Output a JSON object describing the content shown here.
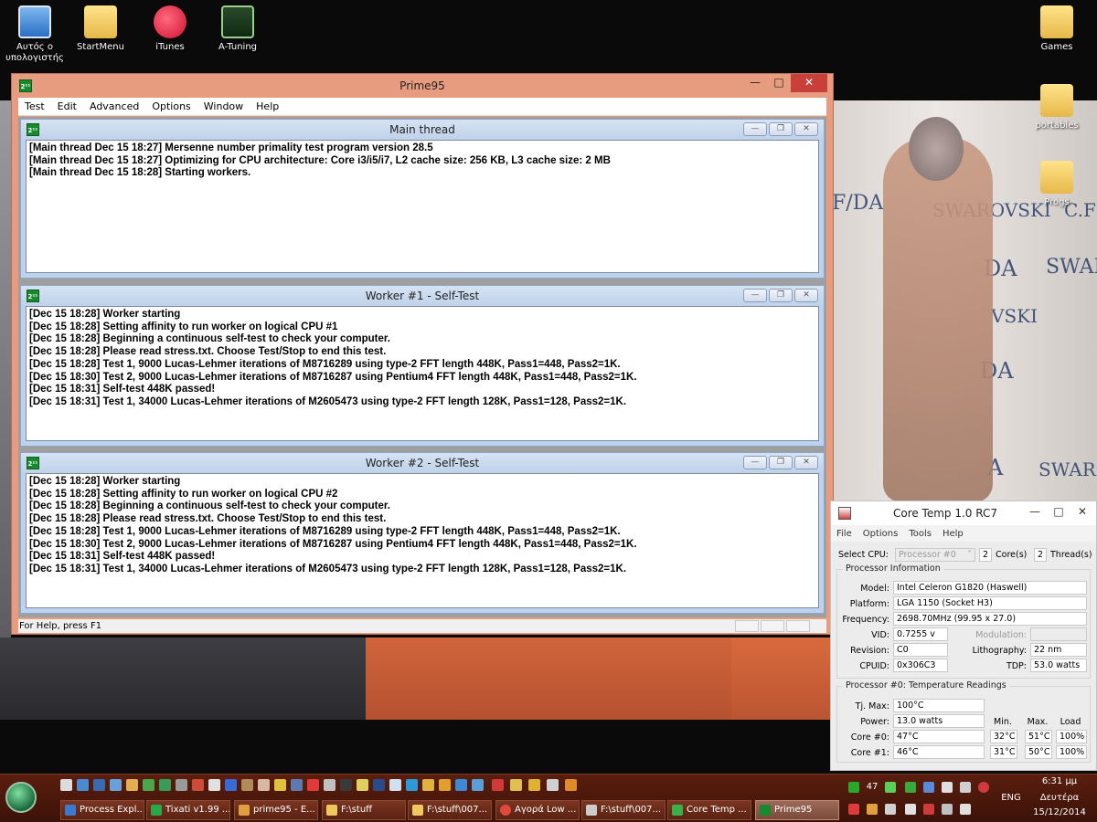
{
  "desktop": {
    "icons": [
      {
        "label": "Αυτός ο υπολογιστής"
      },
      {
        "label": "StartMenu"
      },
      {
        "label": "iTunes"
      },
      {
        "label": "A-Tuning"
      },
      {
        "label": "Games"
      },
      {
        "label": "portables"
      },
      {
        "label": "Progs"
      }
    ],
    "wallpaper_text": [
      "F/DA",
      "SWAROVSKI",
      "C.F",
      "DA",
      "SWAR",
      "VSKI",
      "DA",
      "A",
      "SWARO"
    ]
  },
  "prime95": {
    "title": "Prime95",
    "icon_text": "2¹¹",
    "menu": [
      "Test",
      "Edit",
      "Advanced",
      "Options",
      "Window",
      "Help"
    ],
    "status": "For Help, press F1",
    "windows": [
      {
        "title": "Main thread",
        "lines": [
          "[Main thread Dec 15 18:27] Mersenne number primality test program version 28.5",
          "[Main thread Dec 15 18:27] Optimizing for CPU architecture: Core i3/i5/i7, L2 cache size: 256 KB, L3 cache size: 2 MB",
          "[Main thread Dec 15 18:28] Starting workers."
        ]
      },
      {
        "title": "Worker #1 - Self-Test",
        "lines": [
          "[Dec 15 18:28] Worker starting",
          "[Dec 15 18:28] Setting affinity to run worker on logical CPU #1",
          "[Dec 15 18:28] Beginning a continuous self-test to check your computer.",
          "[Dec 15 18:28] Please read stress.txt.  Choose Test/Stop to end this test.",
          "[Dec 15 18:28] Test 1, 9000 Lucas-Lehmer iterations of M8716289 using type-2 FFT length 448K, Pass1=448, Pass2=1K.",
          "[Dec 15 18:30] Test 2, 9000 Lucas-Lehmer iterations of M8716287 using Pentium4 FFT length 448K, Pass1=448, Pass2=1K.",
          "[Dec 15 18:31] Self-test 448K passed!",
          "[Dec 15 18:31] Test 1, 34000 Lucas-Lehmer iterations of M2605473 using type-2 FFT length 128K, Pass1=128, Pass2=1K."
        ]
      },
      {
        "title": "Worker #2 - Self-Test",
        "lines": [
          "[Dec 15 18:28] Worker starting",
          "[Dec 15 18:28] Setting affinity to run worker on logical CPU #2",
          "[Dec 15 18:28] Beginning a continuous self-test to check your computer.",
          "[Dec 15 18:28] Please read stress.txt.  Choose Test/Stop to end this test.",
          "[Dec 15 18:28] Test 1, 9000 Lucas-Lehmer iterations of M8716289 using type-2 FFT length 448K, Pass1=448, Pass2=1K.",
          "[Dec 15 18:30] Test 2, 9000 Lucas-Lehmer iterations of M8716287 using Pentium4 FFT length 448K, Pass1=448, Pass2=1K.",
          "[Dec 15 18:31] Self-test 448K passed!",
          "[Dec 15 18:31] Test 1, 34000 Lucas-Lehmer iterations of M2605473 using type-2 FFT length 128K, Pass1=128, Pass2=1K."
        ]
      }
    ]
  },
  "coretemp": {
    "title": "Core Temp 1.0 RC7",
    "menu": [
      "File",
      "Options",
      "Tools",
      "Help"
    ],
    "select_cpu_label": "Select CPU:",
    "select_cpu_value": "Processor #0",
    "cores_value": "2",
    "cores_label": "Core(s)",
    "threads_value": "2",
    "threads_label": "Thread(s)",
    "proc_info_title": "Processor Information",
    "model_label": "Model:",
    "model_value": "Intel Celeron G1820 (Haswell)",
    "platform_label": "Platform:",
    "platform_value": "LGA 1150 (Socket H3)",
    "frequency_label": "Frequency:",
    "frequency_value": "2698.70MHz (99.95 x 27.0)",
    "vid_label": "VID:",
    "vid_value": "0.7255 v",
    "modulation_label": "Modulation:",
    "modulation_value": "",
    "revision_label": "Revision:",
    "revision_value": "C0",
    "lithography_label": "Lithography:",
    "lithography_value": "22 nm",
    "cpuid_label": "CPUID:",
    "cpuid_value": "0x306C3",
    "tdp_label": "TDP:",
    "tdp_value": "53.0 watts",
    "temp_title": "Processor #0: Temperature Readings",
    "tjmax_label": "Tj. Max:",
    "tjmax_value": "100°C",
    "power_label": "Power:",
    "power_value": "13.0 watts",
    "col_min": "Min.",
    "col_max": "Max.",
    "col_load": "Load",
    "cores": [
      {
        "label": "Core #0:",
        "temp": "47°C",
        "min": "32°C",
        "max": "51°C",
        "load": "100%"
      },
      {
        "label": "Core #1:",
        "temp": "46°C",
        "min": "31°C",
        "max": "50°C",
        "load": "100%"
      }
    ]
  },
  "taskbar": {
    "buttons": [
      {
        "label": "Process Expl...",
        "icon_color": "#3a7ad0"
      },
      {
        "label": "Tixati v1.99 ...",
        "icon_color": "#2aa84a"
      },
      {
        "label": "prime95 - E...",
        "icon_color": "#e0a040"
      },
      {
        "label": "F:\\stuff",
        "icon_color": "#f0c860"
      },
      {
        "label": "F:\\stuff\\007...",
        "icon_color": "#f0c860"
      },
      {
        "label": "Αγορά Low ...",
        "icon_color": "#e04a3a"
      },
      {
        "label": "F:\\stuff\\007...",
        "icon_color": "#cccccc"
      },
      {
        "label": "Core Temp ...",
        "icon_color": "#3ab04a"
      },
      {
        "label": "Prime95",
        "icon_color": "#178a2e"
      }
    ],
    "tray_number": "47",
    "language": "ENG",
    "time": "6:31 μμ",
    "day": "Δευτέρα",
    "date": "15/12/2014"
  },
  "colors": {
    "prime_frame": "#e89c7f",
    "close_button": "#c7403a",
    "child_title": "#bcd2ee",
    "taskbar": "#4a180a"
  }
}
